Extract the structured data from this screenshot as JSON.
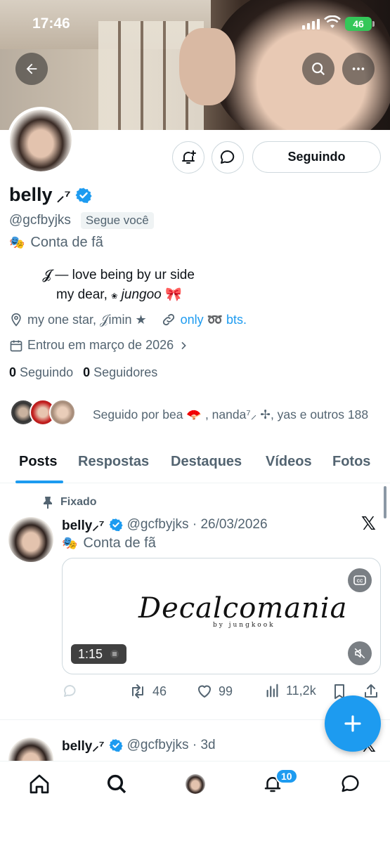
{
  "status_bar": {
    "time": "17:46",
    "battery": "46"
  },
  "profile": {
    "name": "belly",
    "name_suffix": "⸝⁷",
    "handle": "@gcfbyjks",
    "follows_you": "Segue você",
    "category": "Conta de fã",
    "follow_button": "Seguindo",
    "bio_line1": "𝓙 — love being by ur side",
    "bio_line2_prefix": "my dear, ",
    "bio_line2_symbol": "❀",
    "bio_line2_name": "jungoo",
    "bio_line2_suffix": " 🎀",
    "location": "my  one  star,  𝒥imin  ★",
    "link_text": "only  ➿  bts.",
    "joined": "Entrou em março de 2026",
    "following_count": "0",
    "following_label": "Seguindo",
    "followers_count": "0",
    "followers_label": "Seguidores",
    "followed_by": "Seguido por bea 🪭 , nanda⁷⸝ ✢, yas e outros 188"
  },
  "tabs": [
    "Posts",
    "Respostas",
    "Destaques",
    "Vídeos",
    "Fotos"
  ],
  "pinned_post": {
    "pinned_label": "Fixado",
    "author": "belly⸝⁷",
    "handle_date": "@gcfbyjks · 26/03/2026",
    "category": "Conta de fã",
    "media_title": "Decalcomania",
    "media_subtitle": "by jungkook",
    "duration": "1:15",
    "retweets": "46",
    "likes": "99",
    "views": "11,2k"
  },
  "second_post": {
    "author": "belly⸝⁷",
    "handle_date": "@gcfbyjks · 3d"
  },
  "nav": {
    "notifications_badge": "10"
  },
  "colors": {
    "accent": "#1d9bf0",
    "text": "#0f1419",
    "secondary": "#536471"
  }
}
